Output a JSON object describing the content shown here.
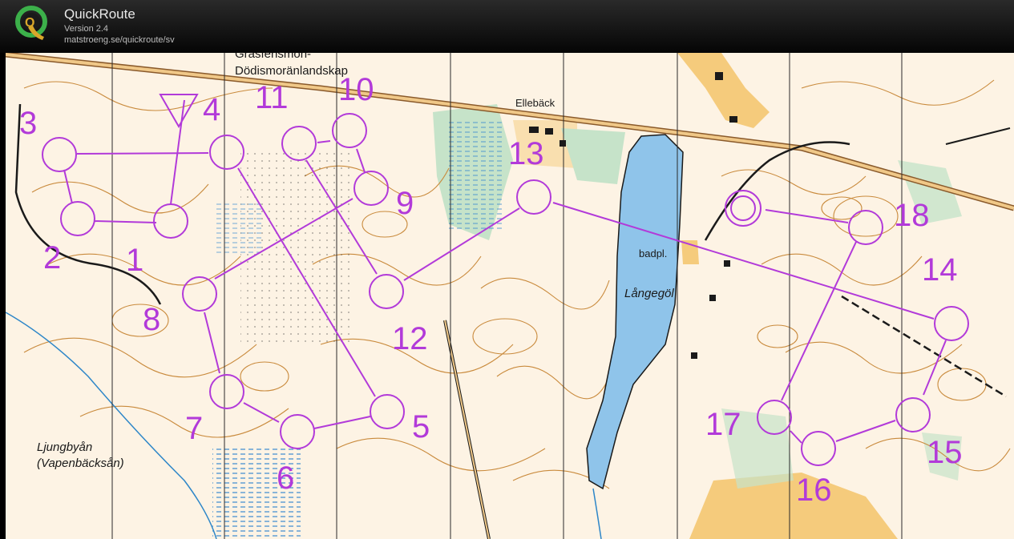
{
  "app": {
    "title": "QuickRoute",
    "version": "Version 2.4",
    "url": "matstroeng.se/quickroute/sv",
    "logo_letter": "Q"
  },
  "map": {
    "place_names": [
      "Gräsfensmon-",
      "Dödismoränlandskap",
      "Ellebäck",
      "badpl.",
      "Långegöl",
      "Ljungbyån",
      "(Vapenbäcksån)"
    ],
    "controls": [
      "1",
      "2",
      "3",
      "4",
      "5",
      "6",
      "7",
      "8",
      "9",
      "10",
      "11",
      "12",
      "13",
      "14",
      "15",
      "16",
      "17",
      "18"
    ],
    "colors": {
      "course": "#b23ad9",
      "contour": "#c98a3c",
      "water": "#8fc4ea",
      "water_outline": "#1a1a1a",
      "paper": "#fdf3e4",
      "open_land": "#f4c46a",
      "green": "#c6e3c9",
      "road": "#8a5a2b"
    },
    "icons": [
      "start-triangle-icon",
      "finish-double-circle-icon"
    ]
  }
}
